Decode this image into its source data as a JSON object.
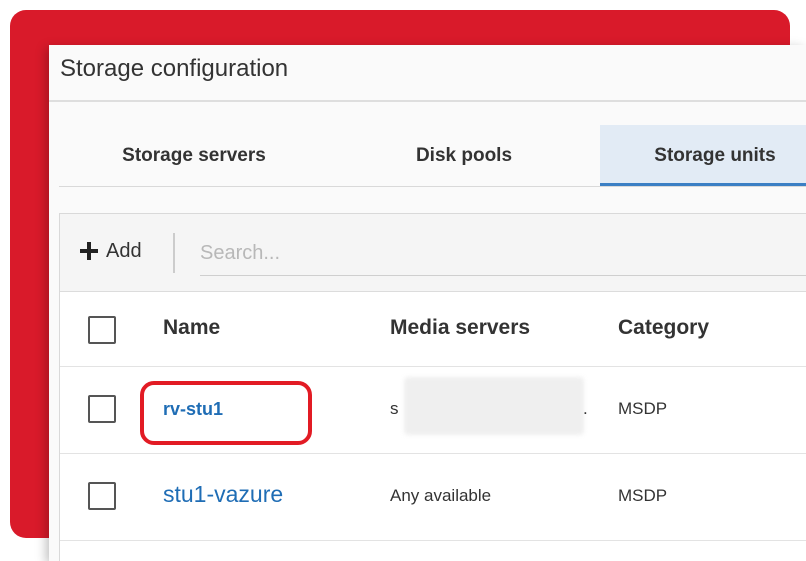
{
  "panel": {
    "title": "Storage configuration"
  },
  "tabs": [
    {
      "label": "Storage servers",
      "active": false
    },
    {
      "label": "Disk pools",
      "active": false
    },
    {
      "label": "Storage units",
      "active": true
    }
  ],
  "toolbar": {
    "add_label": "Add",
    "search_placeholder": "Search..."
  },
  "table": {
    "columns": [
      "Name",
      "Media servers",
      "Category"
    ],
    "rows": [
      {
        "name": "rv-stu1",
        "media_servers": "s",
        "media_servers_suffix": ".",
        "category": "MSDP",
        "highlighted": true
      },
      {
        "name": "stu1-vazure",
        "media_servers": "Any available",
        "category": "MSDP",
        "highlighted": false
      }
    ]
  },
  "colors": {
    "brand_red": "#d91a2a",
    "link_blue": "#1f6db5",
    "tab_active_bg": "#e2ebf5",
    "highlight_red": "#e21b24"
  },
  "icons": {
    "add": "plus-icon"
  }
}
